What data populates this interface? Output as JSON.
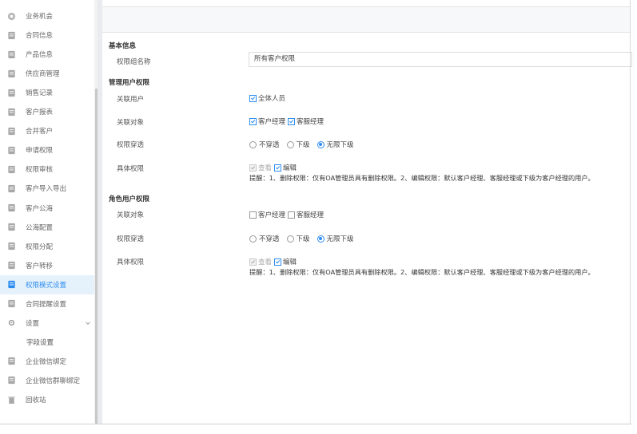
{
  "sidebar": {
    "items": [
      {
        "label": "业务机会",
        "icon": "target-icon"
      },
      {
        "label": "合同信息",
        "icon": "contract-icon"
      },
      {
        "label": "产品信息",
        "icon": "product-icon"
      },
      {
        "label": "供应商管理",
        "icon": "supplier-icon"
      },
      {
        "label": "销售记录",
        "icon": "sales-record-icon"
      },
      {
        "label": "客户报表",
        "icon": "report-icon"
      },
      {
        "label": "合并客户",
        "icon": "merge-icon"
      },
      {
        "label": "申请权限",
        "icon": "apply-permission-icon"
      },
      {
        "label": "权限审核",
        "icon": "audit-icon"
      },
      {
        "label": "客户导入导出",
        "icon": "import-export-icon"
      },
      {
        "label": "客户公海",
        "icon": "public-pool-icon"
      },
      {
        "label": "公海配置",
        "icon": "pool-config-icon"
      },
      {
        "label": "权限分配",
        "icon": "assign-icon"
      },
      {
        "label": "客户转移",
        "icon": "transfer-icon"
      },
      {
        "label": "权限模式设置",
        "icon": "permission-mode-icon"
      },
      {
        "label": "合同提醒设置",
        "icon": "reminder-icon"
      },
      {
        "label": "设置",
        "icon": "gear-icon"
      },
      {
        "label": "字段设置",
        "icon": ""
      },
      {
        "label": "企业微信绑定",
        "icon": "wecom-icon"
      },
      {
        "label": "企业微信群聊绑定",
        "icon": "wecom-group-icon"
      },
      {
        "label": "回收站",
        "icon": "trash-icon"
      }
    ],
    "active_index": 14,
    "active_color": "#2d8cf0"
  },
  "basic": {
    "title": "基本信息",
    "name_label": "权限组名称",
    "name_value": "所有客户权限"
  },
  "manage": {
    "title": "管理用户权限",
    "users_label": "关联用户",
    "users_option": "全体人员",
    "targets_label": "关联对象",
    "target_manager": "客户经理",
    "target_service": "客服经理",
    "penetrate_label": "权限穿透",
    "opt_none": "不穿透",
    "opt_sub": "下级",
    "opt_unlimited": "无限下级",
    "perm_label": "具体权限",
    "perm_view": "查看",
    "perm_edit": "编辑",
    "hint": "提醒：1、删除权限：仅有OA管理员具有删除权限。2、编辑权限：默认客户经理、客服经理或下级为客户经理的用户。"
  },
  "role": {
    "title": "角色用户权限",
    "targets_label": "关联对象",
    "target_manager": "客户经理",
    "target_service": "客服经理",
    "penetrate_label": "权限穿透",
    "opt_none": "不穿透",
    "opt_sub": "下级",
    "opt_unlimited": "无限下级",
    "perm_label": "具体权限",
    "perm_view": "查看",
    "perm_edit": "编辑",
    "hint": "提醒：1、删除权限：仅有OA管理员具有删除权限。2、编辑权限：默认客户经理、客服经理或下级为客户经理的用户。"
  }
}
